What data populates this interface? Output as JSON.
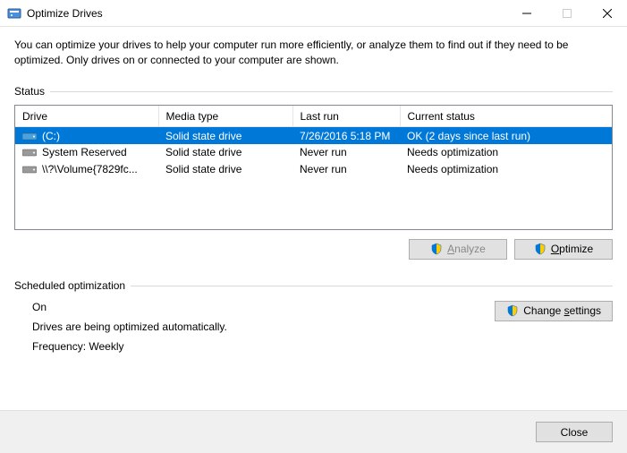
{
  "window": {
    "title": "Optimize Drives"
  },
  "description": "You can optimize your drives to help your computer run more efficiently, or analyze them to find out if they need to be optimized. Only drives on or connected to your computer are shown.",
  "status": {
    "label": "Status",
    "columns": {
      "drive": "Drive",
      "media": "Media type",
      "last": "Last run",
      "current": "Current status"
    },
    "rows": [
      {
        "icon": "disk-blue",
        "drive": "(C:)",
        "media": "Solid state drive",
        "last": "7/26/2016 5:18 PM",
        "current": "OK (2 days since last run)",
        "selected": true
      },
      {
        "icon": "disk-grey",
        "drive": "System Reserved",
        "media": "Solid state drive",
        "last": "Never run",
        "current": "Needs optimization",
        "selected": false
      },
      {
        "icon": "disk-grey",
        "drive": "\\\\?\\Volume{7829fc...",
        "media": "Solid state drive",
        "last": "Never run",
        "current": "Needs optimization",
        "selected": false
      }
    ]
  },
  "buttons": {
    "analyze_pre": "A",
    "analyze_post": "nalyze",
    "optimize_pre": "O",
    "optimize_post": "ptimize",
    "change_pre": "Change ",
    "change_u": "s",
    "change_post": "ettings",
    "close": "Close"
  },
  "scheduled": {
    "label": "Scheduled optimization",
    "on": "On",
    "desc": "Drives are being optimized automatically.",
    "freq": "Frequency: Weekly"
  }
}
